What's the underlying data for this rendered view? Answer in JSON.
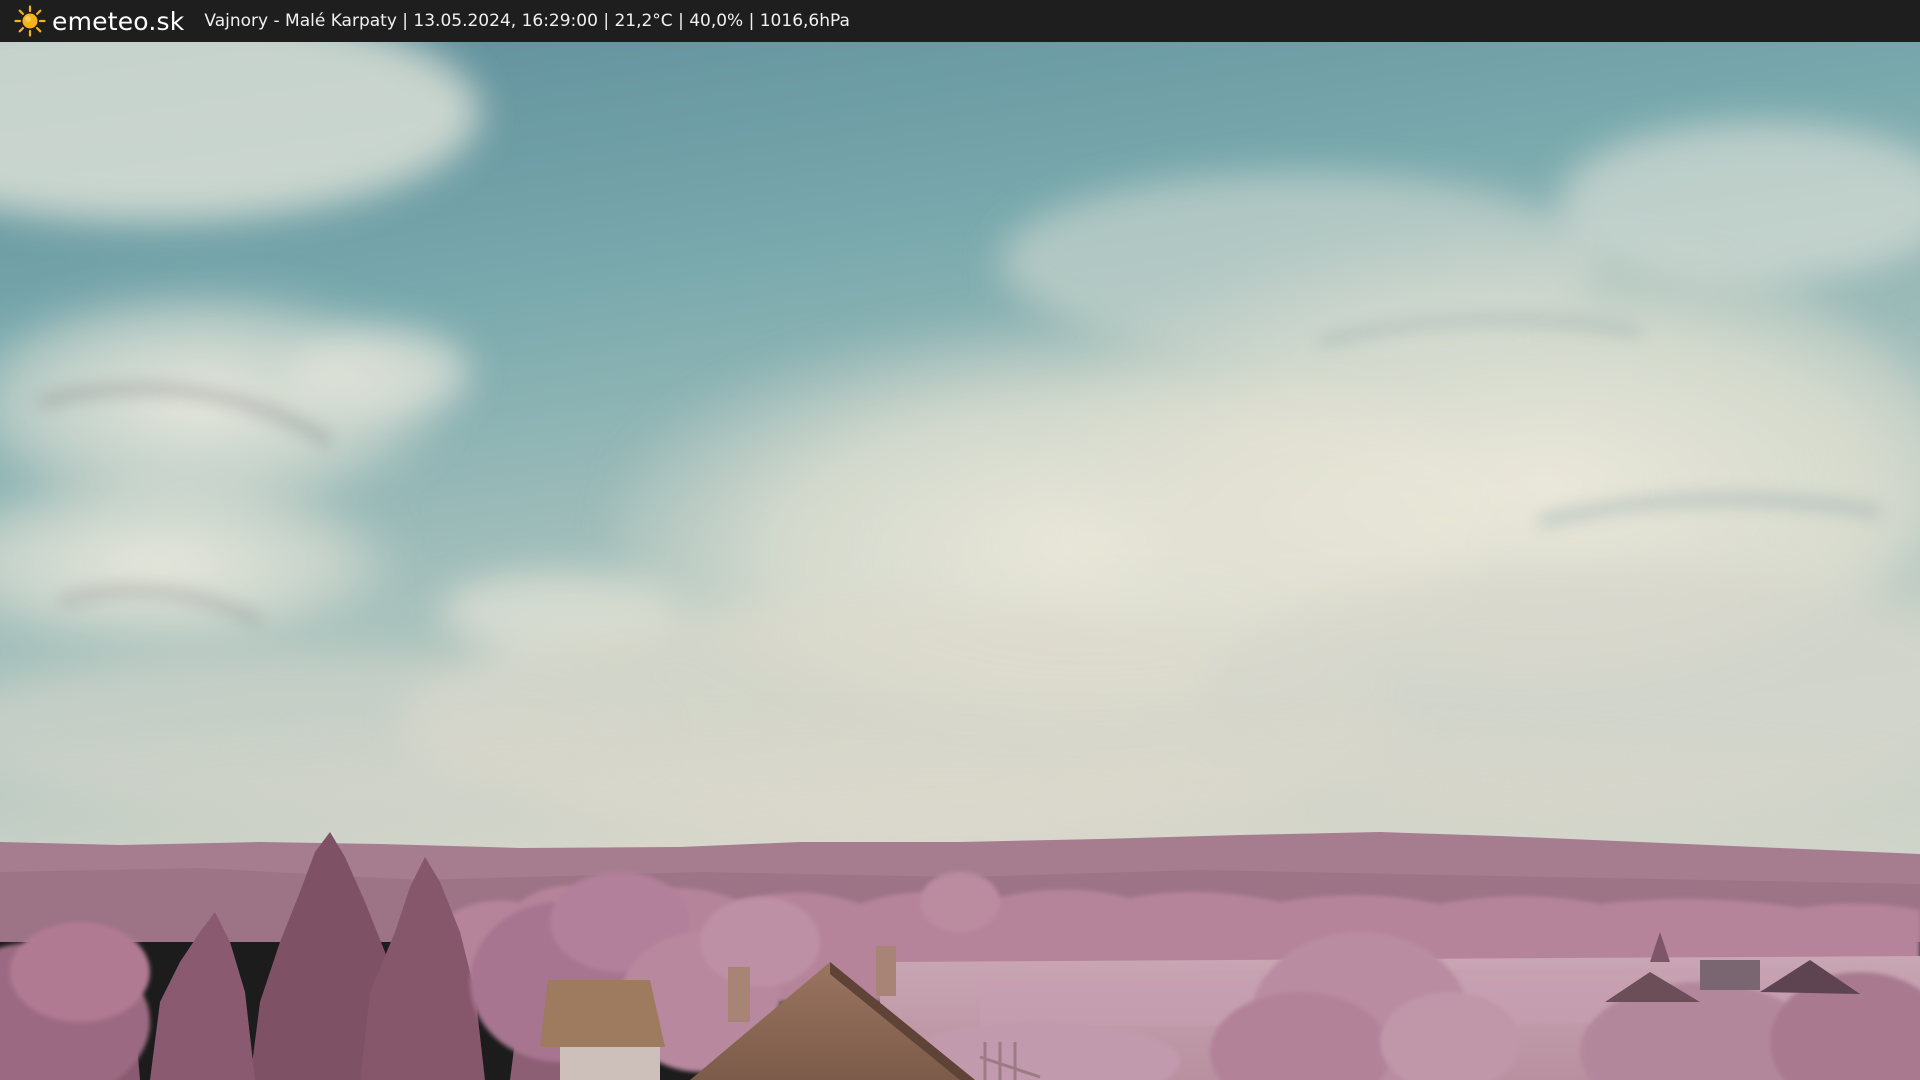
{
  "header": {
    "logo_icon": "sun-icon",
    "site_name": "emeteo.sk",
    "station_info": "Vajnory - Malé Karpaty | 13.05.2024, 16:29:00 | 21,2°C | 40,0% | 1016,6hPa"
  },
  "colors": {
    "bar_background": "#1e1e1e",
    "sun_accent": "#f5b21a",
    "sky_top": "#6f9aa6",
    "foliage": "#b07a93"
  }
}
